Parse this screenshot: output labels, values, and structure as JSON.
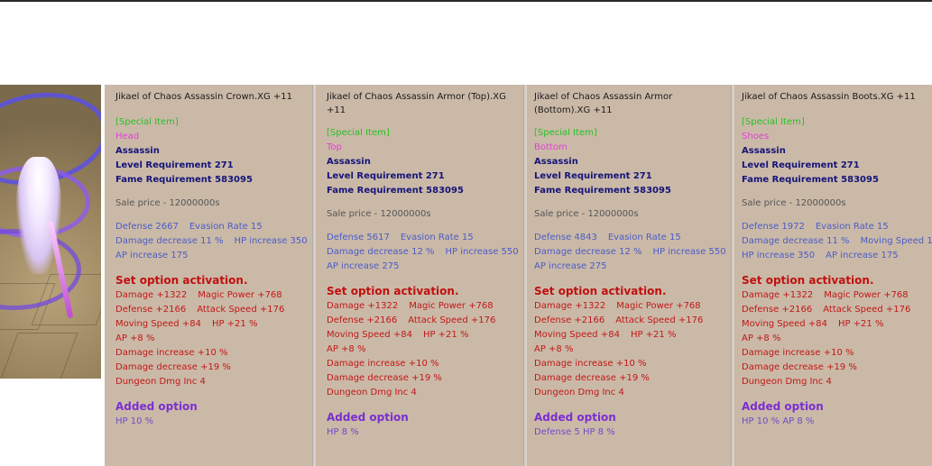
{
  "panels": [
    {
      "title": "Jikael of Chaos Assassin Crown.XG +11",
      "special": "[Special Item]",
      "slot": "Head",
      "class": "Assassin",
      "level": "Level Requirement 271",
      "fame": "Fame Requirement 583095",
      "price": "Sale price - 12000000s",
      "stats": [
        [
          "Defense 2667",
          "Evasion Rate 15"
        ],
        [
          "Damage decrease 11 %",
          "HP increase 350"
        ],
        [
          "AP increase 175"
        ]
      ],
      "set_header": "Set option activation.",
      "set": [
        [
          "Damage +1322",
          "Magic Power +768"
        ],
        [
          "Defense +2166",
          "Attack Speed +176"
        ],
        [
          "Moving Speed +84",
          "HP +21 %"
        ],
        [
          "AP +8 %"
        ],
        [
          "Damage increase +10 %"
        ],
        [
          "Damage decrease +19 %"
        ],
        [
          "Dungeon Dmg Inc 4"
        ]
      ],
      "added_header": "Added option",
      "added": "HP 10 %"
    },
    {
      "title": "Jikael of Chaos Assassin Armor (Top).XG +11",
      "special": "[Special Item]",
      "slot": "Top",
      "class": "Assassin",
      "level": "Level Requirement 271",
      "fame": "Fame Requirement 583095",
      "price": "Sale price - 12000000s",
      "stats": [
        [
          "Defense 5617",
          "Evasion Rate 15"
        ],
        [
          "Damage decrease 12 %",
          "HP increase 550"
        ],
        [
          "AP increase 275"
        ]
      ],
      "set_header": "Set option activation.",
      "set": [
        [
          "Damage +1322",
          "Magic Power +768"
        ],
        [
          "Defense +2166",
          "Attack Speed +176"
        ],
        [
          "Moving Speed +84",
          "HP +21 %"
        ],
        [
          "AP +8 %"
        ],
        [
          "Damage increase +10 %"
        ],
        [
          "Damage decrease +19 %"
        ],
        [
          "Dungeon Dmg Inc 4"
        ]
      ],
      "added_header": "Added option",
      "added": "HP 8 %"
    },
    {
      "title": "Jikael of Chaos Assassin Armor (Bottom).XG +11",
      "special": "[Special Item]",
      "slot": "Bottom",
      "class": "Assassin",
      "level": "Level Requirement 271",
      "fame": "Fame Requirement 583095",
      "price": "Sale price - 12000000s",
      "stats": [
        [
          "Defense 4843",
          "Evasion Rate 15"
        ],
        [
          "Damage decrease 12 %",
          "HP increase 550"
        ],
        [
          "AP increase 275"
        ]
      ],
      "set_header": "Set option activation.",
      "set": [
        [
          "Damage +1322",
          "Magic Power +768"
        ],
        [
          "Defense +2166",
          "Attack Speed +176"
        ],
        [
          "Moving Speed +84",
          "HP +21 %"
        ],
        [
          "AP +8 %"
        ],
        [
          "Damage increase +10 %"
        ],
        [
          "Damage decrease +19 %"
        ],
        [
          "Dungeon Dmg Inc 4"
        ]
      ],
      "added_header": "Added option",
      "added": "Defense 5  HP 8 %"
    },
    {
      "title": "Jikael of Chaos Assassin Boots.XG +11",
      "special": "[Special Item]",
      "slot": "Shoes",
      "class": "Assassin",
      "level": "Level Requirement 271",
      "fame": "Fame Requirement 583095",
      "price": "Sale price - 12000000s",
      "stats": [
        [
          "Defense 1972",
          "Evasion Rate 15"
        ],
        [
          "Damage decrease 11 %",
          "Moving Speed 1"
        ],
        [
          "HP increase 350",
          "AP increase 175"
        ]
      ],
      "set_header": "Set option activation.",
      "set": [
        [
          "Damage +1322",
          "Magic Power +768"
        ],
        [
          "Defense +2166",
          "Attack Speed +176"
        ],
        [
          "Moving Speed +84",
          "HP +21 %"
        ],
        [
          "AP +8 %"
        ],
        [
          "Damage increase +10 %"
        ],
        [
          "Damage decrease +19 %"
        ],
        [
          "Dungeon Dmg Inc 4"
        ]
      ],
      "added_header": "Added option",
      "added": "HP 10 %  AP 8 %"
    }
  ],
  "colors": {
    "panel_bg": "#cbb9a7",
    "special": "#28c028",
    "slot": "#e040d8",
    "set_header": "#c01010",
    "added_header": "#7b2fd0"
  }
}
